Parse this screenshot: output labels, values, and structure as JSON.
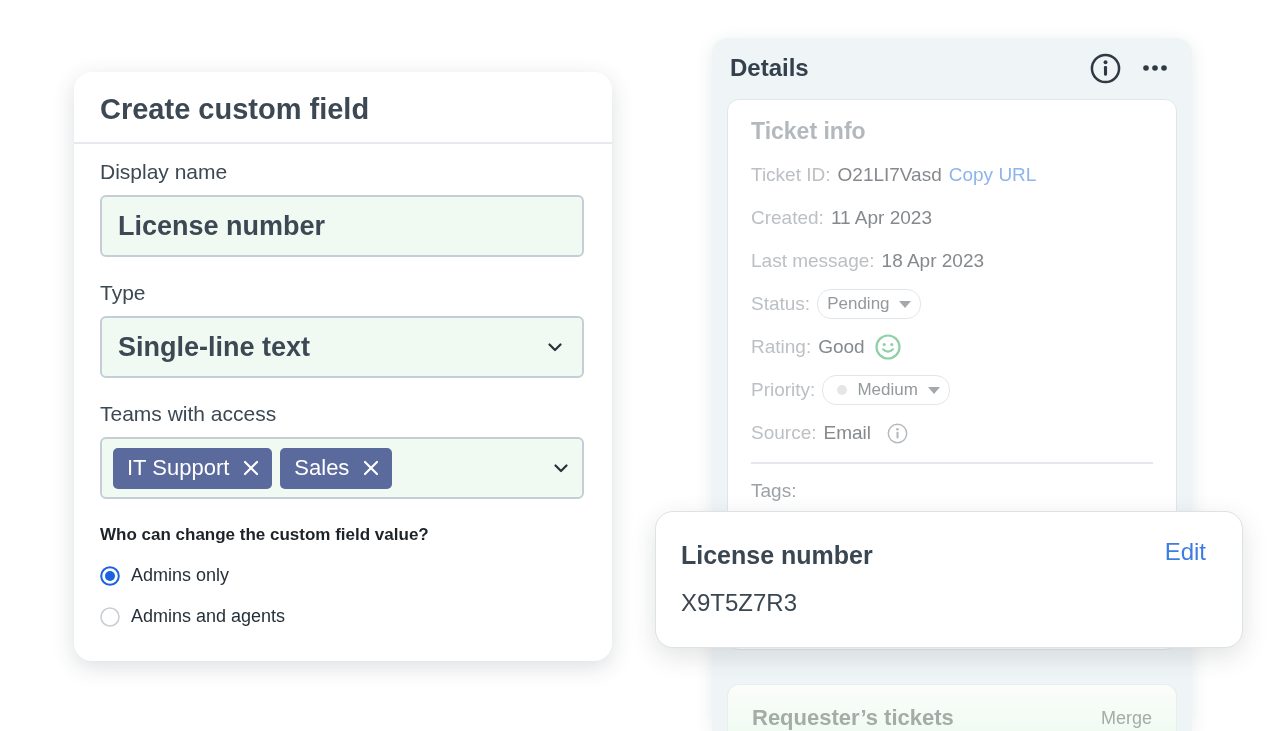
{
  "create_field": {
    "title": "Create custom field",
    "fields": [
      {
        "kind": "text",
        "label": "Display name",
        "value": "License number"
      },
      {
        "kind": "select",
        "label": "Type",
        "value": "Single-line text"
      },
      {
        "kind": "multiselect",
        "label": "Teams with access",
        "chips": [
          "IT Support",
          "Sales"
        ]
      }
    ],
    "permission": {
      "question": "Who can change the custom field value?",
      "options": [
        {
          "label": "Admins only",
          "selected": true
        },
        {
          "label": "Admins and agents",
          "selected": false
        }
      ]
    }
  },
  "details": {
    "title": "Details",
    "ticket_info": {
      "title": "Ticket info",
      "rows": [
        {
          "kind": "link",
          "label": "Ticket ID:",
          "value": "O21LI7Vasd",
          "link": "Copy URL"
        },
        {
          "kind": "text",
          "label": "Created:",
          "value": "11 Apr 2023"
        },
        {
          "kind": "text",
          "label": "Last message:",
          "value": "18 Apr 2023"
        },
        {
          "kind": "dropdown",
          "label": "Status:",
          "value": "Pending"
        },
        {
          "kind": "rating",
          "label": "Rating:",
          "value": "Good"
        },
        {
          "kind": "priority",
          "label": "Priority:",
          "value": "Medium"
        },
        {
          "kind": "info",
          "label": "Source:",
          "value": "Email"
        }
      ],
      "tags_label": "Tags:"
    },
    "requester_tickets": {
      "title": "Requester’s tickets",
      "action": "Merge"
    }
  },
  "popup": {
    "title": "License number",
    "action": "Edit",
    "value": "X9T5Z7R3"
  }
}
